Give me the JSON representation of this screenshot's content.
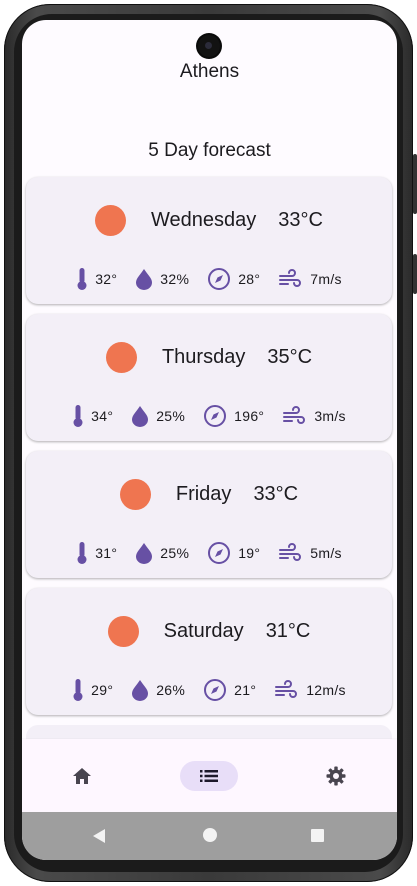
{
  "app": {
    "city": "Athens",
    "section_title": "5 Day forecast"
  },
  "colors": {
    "sun": "#ef7550",
    "accent": "#6750a4",
    "card_bg": "#f3eff7",
    "nav_indicator": "#e8def8"
  },
  "forecast": [
    {
      "day": "Wednesday",
      "temp": "33°C",
      "icon": "sun-icon",
      "feels_like": "32°",
      "humidity": "32%",
      "wind_direction": "28°",
      "wind_speed": "7m/s"
    },
    {
      "day": "Thursday",
      "temp": "35°C",
      "icon": "sun-icon",
      "feels_like": "34°",
      "humidity": "25%",
      "wind_direction": "196°",
      "wind_speed": "3m/s"
    },
    {
      "day": "Friday",
      "temp": "33°C",
      "icon": "sun-icon",
      "feels_like": "31°",
      "humidity": "25%",
      "wind_direction": "19°",
      "wind_speed": "5m/s"
    },
    {
      "day": "Saturday",
      "temp": "31°C",
      "icon": "sun-icon",
      "feels_like": "29°",
      "humidity": "26%",
      "wind_direction": "21°",
      "wind_speed": "12m/s"
    }
  ],
  "nav": {
    "items": [
      {
        "icon": "home-icon",
        "selected": false
      },
      {
        "icon": "list-icon",
        "selected": true
      },
      {
        "icon": "settings-icon",
        "selected": false
      }
    ]
  },
  "system_nav": {
    "icons": [
      "back-icon",
      "home-circle-icon",
      "recents-icon"
    ]
  }
}
